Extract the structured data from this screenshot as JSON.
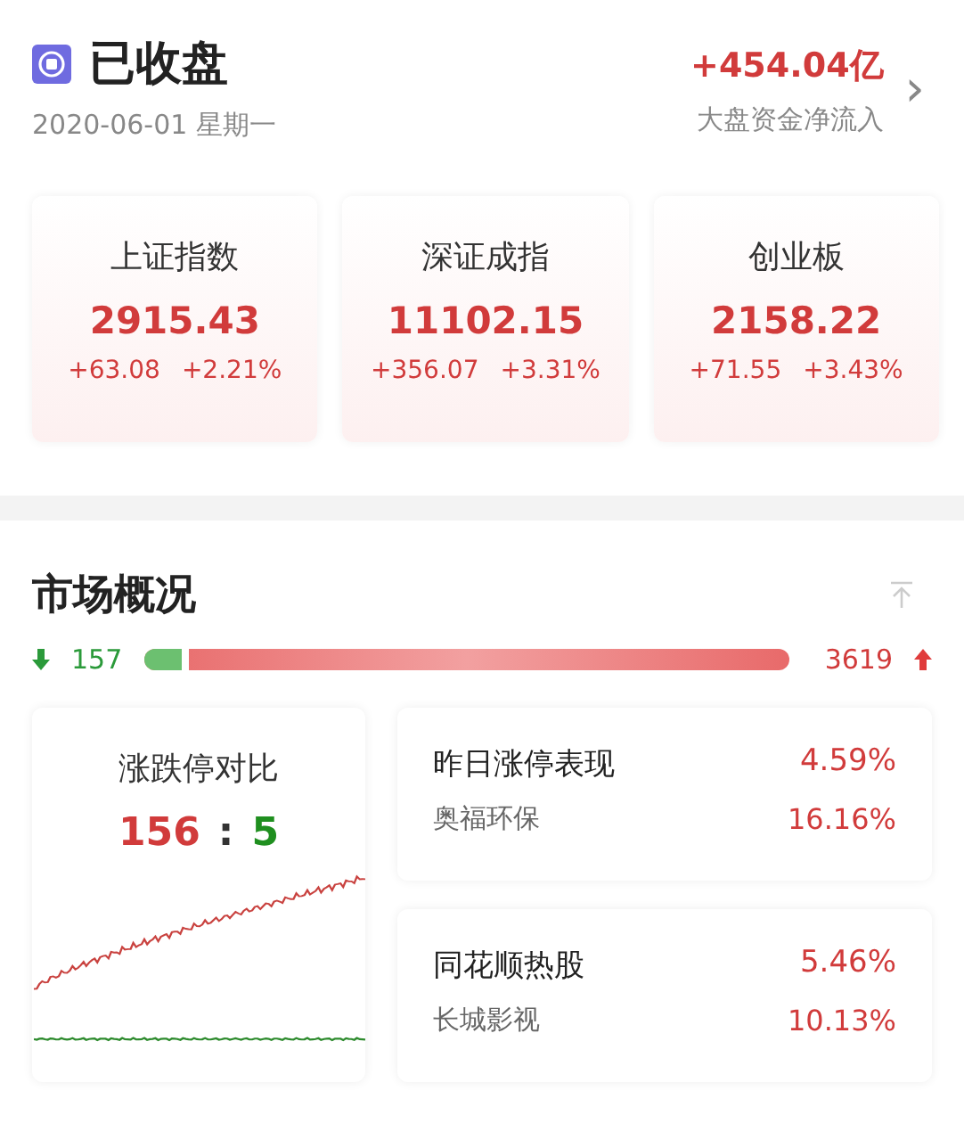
{
  "header": {
    "status": "已收盘",
    "date": "2020-06-01 星期一",
    "net_inflow": "+454.04亿",
    "inflow_label": "大盘资金净流入",
    "chevron": "›"
  },
  "indices": [
    {
      "name": "上证指数",
      "value": "2915.43",
      "change": "+63.08",
      "percent": "+2.21%"
    },
    {
      "name": "深证成指",
      "value": "11102.15",
      "change": "+356.07",
      "percent": "+3.31%"
    },
    {
      "name": "创业板",
      "value": "2158.22",
      "change": "+71.55",
      "percent": "+3.43%"
    }
  ],
  "market": {
    "title": "市场概况",
    "breadth": {
      "down": "157",
      "up": "3619",
      "level": 0.06
    },
    "limit_card": {
      "title": "涨跌停对比",
      "up": "156",
      "separator": ":",
      "down": "5"
    },
    "panels": [
      {
        "title": "昨日涨停表现",
        "title_value": "4.59%",
        "stock": "奥福环保",
        "stock_value": "16.16%"
      },
      {
        "title": "同花顺热股",
        "title_value": "5.46%",
        "stock": "长城影视",
        "stock_value": "10.13%"
      }
    ]
  }
}
